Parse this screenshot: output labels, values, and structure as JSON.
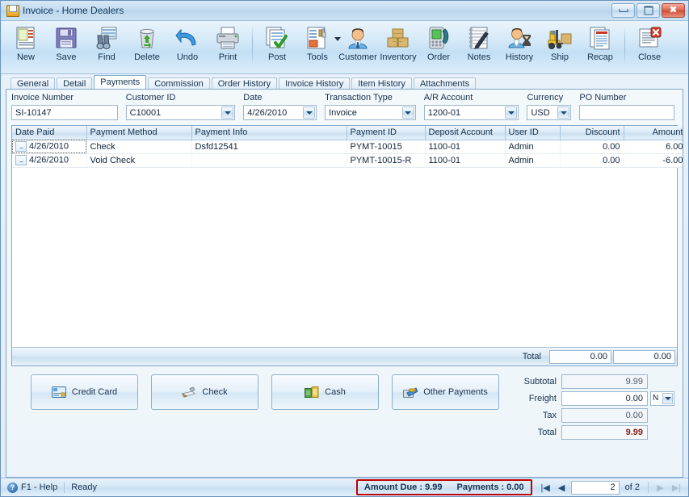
{
  "window": {
    "title": "Invoice - Home Dealers",
    "icon": "invoice-window-icon",
    "minimize_label": "Minimize",
    "maximize_label": "Maximize",
    "close_label": "Close"
  },
  "toolbar": {
    "items": [
      {
        "label": "New",
        "icon": "new-document-icon"
      },
      {
        "label": "Save",
        "icon": "floppy-disk-icon"
      },
      {
        "label": "Find",
        "icon": "binoculars-icon"
      },
      {
        "label": "Delete",
        "icon": "recycle-bin-icon"
      },
      {
        "label": "Undo",
        "icon": "undo-arrow-icon"
      },
      {
        "label": "Print",
        "icon": "printer-icon"
      },
      {
        "label": "Post",
        "icon": "post-checkmark-icon"
      },
      {
        "label": "Tools",
        "icon": "tools-wrench-icon"
      },
      {
        "label": "Customer",
        "icon": "customer-person-icon"
      },
      {
        "label": "Inventory",
        "icon": "inventory-boxes-icon"
      },
      {
        "label": "Order",
        "icon": "order-phone-icon"
      },
      {
        "label": "Notes",
        "icon": "notes-pad-icon"
      },
      {
        "label": "History",
        "icon": "history-hourglass-icon"
      },
      {
        "label": "Ship",
        "icon": "forklift-icon"
      },
      {
        "label": "Recap",
        "icon": "recap-report-icon"
      },
      {
        "label": "Close",
        "icon": "close-window-icon"
      }
    ]
  },
  "tabs": [
    {
      "label": "General",
      "active": false
    },
    {
      "label": "Detail",
      "active": false
    },
    {
      "label": "Payments",
      "active": true
    },
    {
      "label": "Commission",
      "active": false
    },
    {
      "label": "Order History",
      "active": false
    },
    {
      "label": "Invoice History",
      "active": false
    },
    {
      "label": "Item History",
      "active": false
    },
    {
      "label": "Attachments",
      "active": false
    }
  ],
  "form": {
    "invoice_number": {
      "label": "Invoice Number",
      "value": "SI-10147",
      "placeholder": ""
    },
    "customer_id": {
      "label": "Customer ID",
      "value": "C10001",
      "placeholder": ""
    },
    "date": {
      "label": "Date",
      "value": "4/26/2010",
      "placeholder": ""
    },
    "transaction_type": {
      "label": "Transaction Type",
      "value": "Invoice",
      "placeholder": ""
    },
    "ar_account": {
      "label": "A/R Account",
      "value": "1200-01",
      "placeholder": ""
    },
    "currency": {
      "label": "Currency",
      "value": "USD",
      "placeholder": ""
    },
    "po_number": {
      "label": "PO Number",
      "value": "",
      "placeholder": ""
    }
  },
  "grid": {
    "columns": [
      {
        "label": "Date Paid",
        "align": "left"
      },
      {
        "label": "Payment Method",
        "align": "left"
      },
      {
        "label": "Payment Info",
        "align": "left"
      },
      {
        "label": "Payment ID",
        "align": "left"
      },
      {
        "label": "Deposit Account",
        "align": "left"
      },
      {
        "label": "User ID",
        "align": "left"
      },
      {
        "label": "Discount",
        "align": "right"
      },
      {
        "label": "Amount",
        "align": "right"
      }
    ],
    "rows": [
      {
        "date_paid": "4/26/2010",
        "payment_method": "Check",
        "payment_info": "Dsfd12541",
        "payment_id": "PYMT-10015",
        "deposit_account": "1100-01",
        "user_id": "Admin",
        "discount": "0.00",
        "amount": "6.00",
        "selected": true
      },
      {
        "date_paid": "4/26/2010",
        "payment_method": "Void Check",
        "payment_info": "",
        "payment_id": "PYMT-10015-R",
        "deposit_account": "1100-01",
        "user_id": "Admin",
        "discount": "0.00",
        "amount": "-6.00",
        "selected": false
      }
    ],
    "ellipsis_label": "...",
    "total_label": "Total",
    "total_discount": "0.00",
    "total_amount": "0.00"
  },
  "payment_buttons": [
    {
      "label": "Credit Card",
      "icon": "credit-card-icon"
    },
    {
      "label": "Check",
      "icon": "check-pen-icon"
    },
    {
      "label": "Cash",
      "icon": "cash-money-icon"
    },
    {
      "label": "Other Payments",
      "icon": "other-payments-icon"
    }
  ],
  "totals": {
    "subtotal": {
      "label": "Subtotal",
      "value": "9.99"
    },
    "freight": {
      "label": "Freight",
      "value": "0.00",
      "unit": "N"
    },
    "tax": {
      "label": "Tax",
      "value": "0.00"
    },
    "total": {
      "label": "Total",
      "value": "9.99"
    }
  },
  "statusbar": {
    "help": "F1 - Help",
    "status": "Ready",
    "amount_due": "Amount Due : 9.99",
    "payments": "Payments : 0.00",
    "first_label": "|◀",
    "prev_label": "◀",
    "next_label": "▶",
    "last_label": "▶|",
    "page_value": "2",
    "of_label": "of  2"
  },
  "colors": {
    "accent": "#7fa8cc",
    "total_red": "#8b1a1a",
    "highlight_red": "#c00000",
    "title_text": "#123a5e"
  }
}
